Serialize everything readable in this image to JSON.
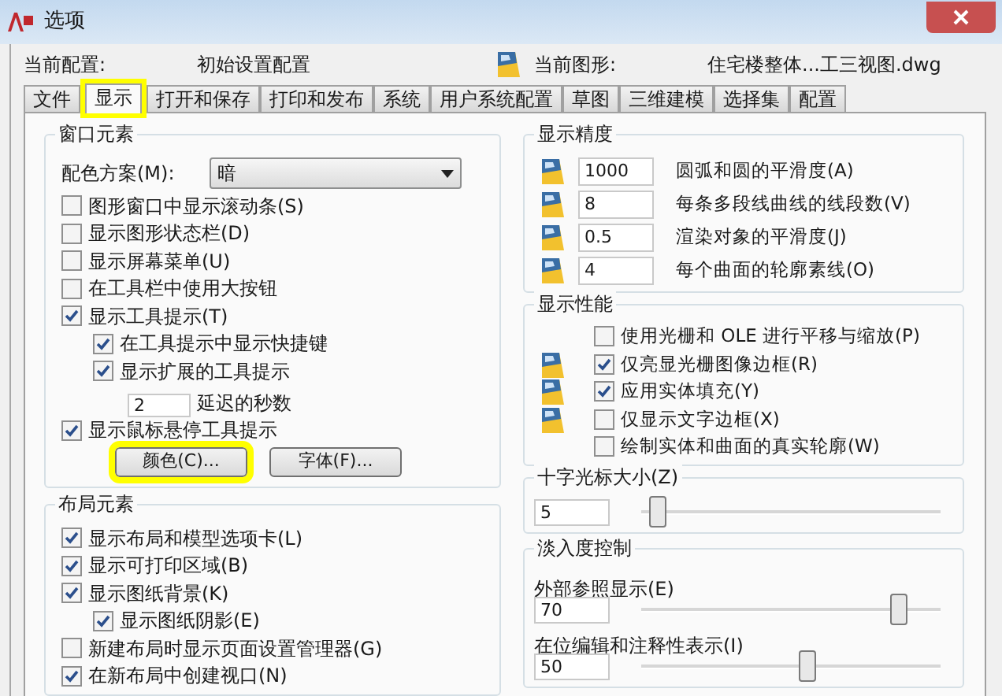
{
  "window": {
    "title": "选项"
  },
  "profile": {
    "label": "当前配置:",
    "value": "初始设置配置"
  },
  "drawing": {
    "label": "当前图形:",
    "value": "住宅楼整体...工三视图.dwg"
  },
  "tabs": [
    {
      "label": "文件",
      "selected": false,
      "highlighted": false
    },
    {
      "label": "显示",
      "selected": true,
      "highlighted": true
    },
    {
      "label": "打开和保存",
      "selected": false,
      "highlighted": false
    },
    {
      "label": "打印和发布",
      "selected": false,
      "highlighted": false
    },
    {
      "label": "系统",
      "selected": false,
      "highlighted": false
    },
    {
      "label": "用户系统配置",
      "selected": false,
      "highlighted": false
    },
    {
      "label": "草图",
      "selected": false,
      "highlighted": false
    },
    {
      "label": "三维建模",
      "selected": false,
      "highlighted": false
    },
    {
      "label": "选择集",
      "selected": false,
      "highlighted": false
    },
    {
      "label": "配置",
      "selected": false,
      "highlighted": false
    }
  ],
  "window_elements": {
    "title": "窗口元素",
    "color_scheme": {
      "label": "配色方案(M):",
      "value": "暗"
    },
    "options": [
      {
        "kind": "checkbox",
        "label": "图形窗口中显示滚动条(S)",
        "checked": false
      },
      {
        "kind": "checkbox",
        "label": "显示图形状态栏(D)",
        "checked": false
      },
      {
        "kind": "checkbox",
        "label": "显示屏幕菜单(U)",
        "checked": false
      },
      {
        "kind": "checkbox",
        "label": "在工具栏中使用大按钮",
        "checked": false
      },
      {
        "kind": "checkbox",
        "label": "显示工具提示(T)",
        "checked": true
      },
      {
        "kind": "sub_checkbox",
        "label": "在工具提示中显示快捷键",
        "checked": true
      },
      {
        "kind": "sub_checkbox",
        "label": "显示扩展的工具提示",
        "checked": true,
        "delay": {
          "value": "2",
          "label": "延迟的秒数"
        }
      },
      {
        "kind": "checkbox",
        "label": "显示鼠标悬停工具提示",
        "checked": true
      }
    ],
    "buttons": [
      {
        "label": "颜色(C)...",
        "highlighted": true
      },
      {
        "label": "字体(F)...",
        "highlighted": false
      }
    ]
  },
  "layout_elements": {
    "title": "布局元素",
    "options": [
      {
        "kind": "checkbox",
        "label": "显示布局和模型选项卡(L)",
        "checked": true
      },
      {
        "kind": "checkbox",
        "label": "显示可打印区域(B)",
        "checked": true
      },
      {
        "kind": "checkbox",
        "label": "显示图纸背景(K)",
        "checked": true
      },
      {
        "kind": "sub_checkbox",
        "label": "显示图纸阴影(E)",
        "checked": true
      },
      {
        "kind": "checkbox",
        "label": "新建布局时显示页面设置管理器(G)",
        "checked": false
      },
      {
        "kind": "checkbox",
        "label": "在新布局中创建视口(N)",
        "checked": true
      }
    ]
  },
  "display_resolution": {
    "title": "显示精度",
    "rows": [
      {
        "value": "1000",
        "label": "圆弧和圆的平滑度(A)"
      },
      {
        "value": "8",
        "label": "每条多段线曲线的线段数(V)"
      },
      {
        "value": "0.5",
        "label": "渲染对象的平滑度(J)"
      },
      {
        "value": "4",
        "label": "每个曲面的轮廓素线(O)"
      }
    ]
  },
  "display_performance": {
    "title": "显示性能",
    "rows": [
      {
        "label": "使用光栅和 OLE 进行平移与缩放(P)",
        "checked": false,
        "saved_in_drawing": false
      },
      {
        "label": "仅亮显光栅图像边框(R)",
        "checked": true,
        "saved_in_drawing": true
      },
      {
        "label": "应用实体填充(Y)",
        "checked": true,
        "saved_in_drawing": true
      },
      {
        "label": "仅显示文字边框(X)",
        "checked": false,
        "saved_in_drawing": true
      },
      {
        "label": "绘制实体和曲面的真实轮廓(W)",
        "checked": false,
        "saved_in_drawing": false
      }
    ]
  },
  "crosshair_size": {
    "title": "十字光标大小(Z)",
    "value": "5",
    "level": 0.05
  },
  "fade_control": {
    "title": "淡入度控制",
    "controls": [
      {
        "label": "外部参照显示(E)",
        "value": "70",
        "level": 0.86
      },
      {
        "label": "在位编辑和注释性表示(I)",
        "value": "50",
        "level": 0.55
      }
    ]
  }
}
